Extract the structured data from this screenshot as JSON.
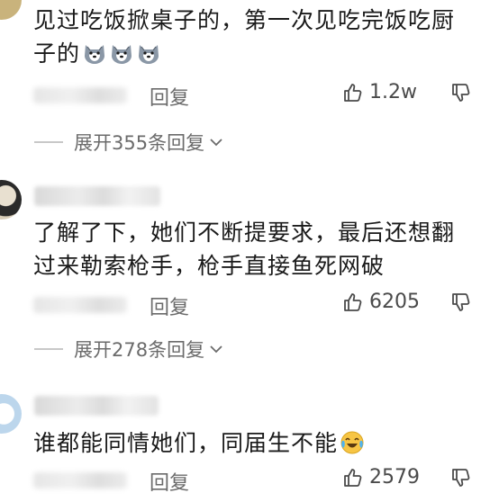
{
  "comments": [
    {
      "text_line1": "见过吃饭掀桌子的，第一次见吃完饭吃厨",
      "text_line2": "子的",
      "emoji": "dog-emoji",
      "reply_label": "回复",
      "like_count": "1.2w",
      "expand_label": "展开355条回复"
    },
    {
      "text_line1": "了解了下，她们不断提要求，最后还想翻",
      "text_line2": "过来勒索枪手，枪手直接鱼死网破",
      "reply_label": "回复",
      "like_count": "6205",
      "expand_label": "展开278条回复"
    },
    {
      "text_line1": "谁都能同情她们，同届生不能",
      "emoji": "crying-laughing-emoji",
      "reply_label": "回复",
      "like_count": "2579"
    }
  ],
  "icons": {
    "like": "thumbs-up-icon",
    "dislike": "thumbs-down-icon",
    "expand": "chevron-down-icon"
  },
  "colors": {
    "text": "#1a1a1a",
    "secondary": "#6b6b6b",
    "emoji_face": "#f7c544"
  }
}
